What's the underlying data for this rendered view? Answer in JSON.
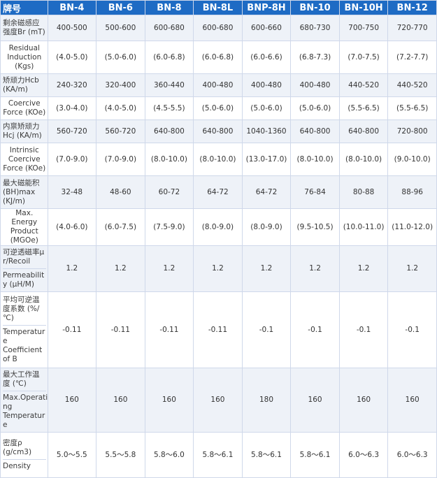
{
  "header": {
    "first": "牌号",
    "grades": [
      "BN-4",
      "BN-6",
      "BN-8",
      "BN-8L",
      "BNP-8H",
      "BN-10",
      "BN-10H",
      "BN-12"
    ]
  },
  "rows": [
    {
      "label_lines": [
        "剩余磁感应",
        "强度Br (mT)"
      ],
      "values": [
        "400-500",
        "500-600",
        "600-680",
        "600-680",
        "600-660",
        "680-730",
        "700-750",
        "720-770"
      ]
    },
    {
      "label_lines": [
        "Residual",
        "Induction",
        "(Kgs)"
      ],
      "values": [
        "(4.0-5.0)",
        "(5.0-6.0)",
        "(6.0-6.8)",
        "(6.0-6.8)",
        "(6.0-6.6)",
        "(6.8-7.3)",
        "(7.0-7.5)",
        "(7.2-7.7)"
      ]
    },
    {
      "label_lines": [
        "矫顽力Hcb",
        "(KA/m)"
      ],
      "values": [
        "240-320",
        "320-400",
        "360-440",
        "400-480",
        "400-480",
        "400-480",
        "440-520",
        "440-520"
      ]
    },
    {
      "label_lines": [
        "Coercive",
        "Force (KOe)"
      ],
      "values": [
        "(3.0-4.0)",
        "(4.0-5.0)",
        "(4.5-5.5)",
        "(5.0-6.0)",
        "(5.0-6.0)",
        "(5.0-6.0)",
        "(5.5-6.5)",
        "(5.5-6.5)"
      ]
    },
    {
      "label_lines": [
        "内禀矫顽力",
        "Hcj (KA/m)"
      ],
      "values": [
        "560-720",
        "560-720",
        "640-800",
        "640-800",
        "1040-1360",
        "640-800",
        "640-800",
        "720-800"
      ]
    },
    {
      "label_lines": [
        "Intrinsic",
        "Coercive",
        "Force (KOe)"
      ],
      "values": [
        "(7.0-9.0)",
        "(7.0-9.0)",
        "(8.0-10.0)",
        "(8.0-10.0)",
        "(13.0-17.0)",
        "(8.0-10.0)",
        "(8.0-10.0)",
        "(9.0-10.0)"
      ]
    },
    {
      "label_lines": [
        "最大磁能积",
        "(BH)max",
        "(KJ/m)"
      ],
      "values": [
        "32-48",
        "48-60",
        "60-72",
        "64-72",
        "64-72",
        "76-84",
        "80-88",
        "88-96"
      ]
    },
    {
      "label_lines": [
        "Max. Energy",
        "Product",
        "(MGOe)"
      ],
      "values": [
        "(4.0-6.0)",
        "(6.0-7.5)",
        "(7.5-9.0)",
        "(8.0-9.0)",
        "(8.0-9.0)",
        "(9.5-10.5)",
        "(10.0-11.0)",
        "(11.0-12.0)"
      ]
    },
    {
      "label_parts": [
        [
          "可逆透磁率μ",
          "r/Recoil"
        ],
        [
          "Permeabilit",
          "y (μH/M)"
        ]
      ],
      "values": [
        "1.2",
        "1.2",
        "1.2",
        "1.2",
        "1.2",
        "1.2",
        "1.2",
        "1.2"
      ]
    },
    {
      "label_parts": [
        [
          "平均可逆温",
          "度系数 (%/",
          "℃)"
        ],
        [
          "Temperatur",
          "e",
          "Coefficient",
          "of B"
        ]
      ],
      "values": [
        "-0.11",
        "-0.11",
        "-0.11",
        "-0.11",
        "-0.1",
        "-0.1",
        "-0.1",
        "-0.1"
      ]
    },
    {
      "label_parts": [
        [
          "最大工作温",
          "度 (℃)"
        ],
        [
          "Max.Operati",
          "ng",
          "Temperatur",
          "e"
        ]
      ],
      "values": [
        "160",
        "160",
        "160",
        "160",
        "180",
        "160",
        "160",
        "160"
      ]
    },
    {
      "label_parts": [
        [
          "密度ρ",
          "(g/cm3)"
        ],
        [
          "Density"
        ]
      ],
      "values": [
        "5.0～5.5",
        "5.5～5.8",
        "5.8～6.0",
        "5.8～6.1",
        "5.8～6.1",
        "5.8～6.1",
        "6.0～6.3",
        "6.0～6.3"
      ]
    }
  ]
}
